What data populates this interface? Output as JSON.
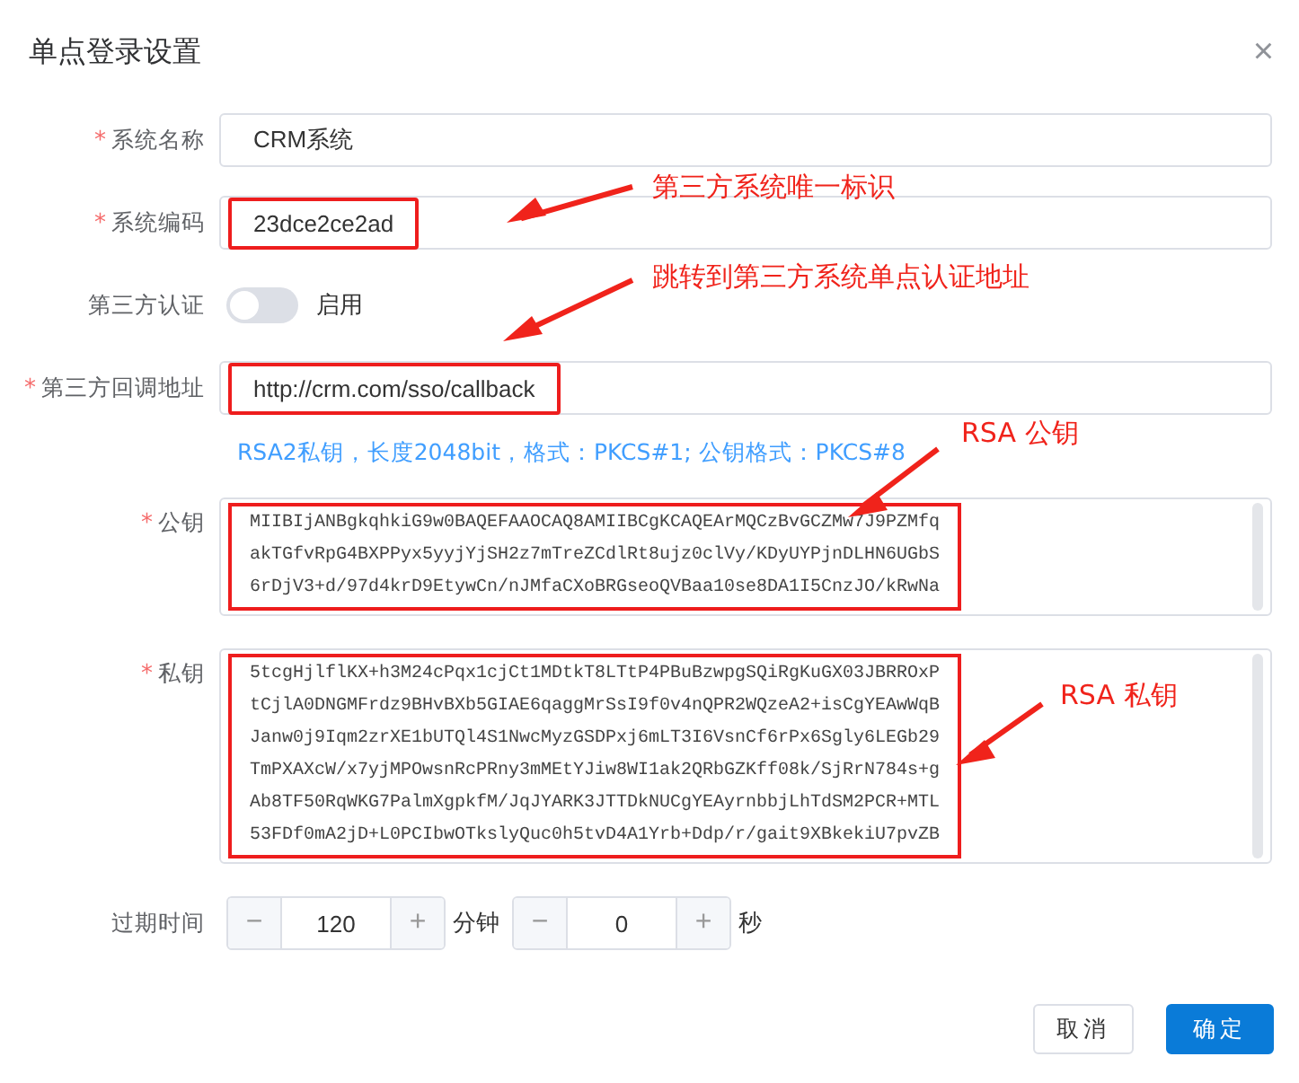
{
  "dialog": {
    "title": "单点登录设置",
    "close": "×"
  },
  "fields": [
    {
      "kind": "input",
      "required_mark": "*",
      "label": "系统名称",
      "value": "CRM系统",
      "highlighted": false
    },
    {
      "kind": "input",
      "required_mark": "*",
      "label": "系统编码",
      "value": "23dce2ce2ad",
      "highlighted": true
    },
    {
      "kind": "switch",
      "label": "第三方认证",
      "on": false,
      "switch_label": "启用"
    },
    {
      "kind": "input",
      "required_mark": "*",
      "label": "第三方回调地址",
      "value": "http://crm.com/sso/callback",
      "highlighted": true
    },
    {
      "kind": "hint",
      "text": "RSA2私钥，长度2048bit，格式：PKCS#1; 公钥格式：PKCS#8"
    },
    {
      "kind": "textarea",
      "required_mark": "*",
      "label": "公钥",
      "highlighted": true,
      "lines": [
        "MIIBIjANBgkqhkiG9w0BAQEFAAOCAQ8AMIIBCgKCAQEArMQCzBvGCZMw7J9PZMfq",
        "akTGfvRpG4BXPPyx5yyjYjSH2z7mTreZCdlRt8ujz0clVy/KDyUYPjnDLHN6UGbS",
        "6rDjV3+d/97d4krD9EtywCn/nJMfaCXoBRGseoQVBaa10se8DA1I5CnzJO/kRwNa"
      ]
    },
    {
      "kind": "textarea",
      "required_mark": "*",
      "label": "私钥",
      "highlighted": true,
      "lines": [
        "5tcgHjlflKX+h3M24cPqx1cjCt1MDtkT8LTtP4PBuBzwpgSQiRgKuGX03JBRROxP",
        "tCjlA0DNGMFrdz9BHvBXb5GIAE6qaggMrSsI9f0v4nQPR2WQzeA2+isCgYEAwWqB",
        "Janw0j9Iqm2zrXE1bUTQl4S1NwcMyzGSDPxj6mLT3I6VsnCf6rPx6Sgly6LEGb29",
        "TmPXAXcW/x7yjMPOwsnRcPRny3mMEtYJiw8WI1ak2QRbGZKff08k/SjRrN784s+g",
        "Ab8TF50RqWKG7PalmXgpkfM/JqJYARK3JTTDkNUCgYEAyrnbbjLhTdSM2PCR+MTL",
        "53FDf0mA2jD+L0PCIbwOTkslyQuc0h5tvD4A1Yrb+Ddp/r/gait9XBkekiU7pvZB"
      ]
    },
    {
      "kind": "duration",
      "label": "过期时间",
      "parts": [
        {
          "minus": "−",
          "value": "120",
          "plus": "+",
          "unit": "分钟"
        },
        {
          "minus": "−",
          "value": "0",
          "plus": "+",
          "unit": "秒"
        }
      ]
    }
  ],
  "annotations": [
    {
      "text": "第三方系统唯一标识"
    },
    {
      "text": "跳转到第三方系统单点认证地址"
    },
    {
      "text": "RSA 公钥"
    },
    {
      "text": "RSA 私钥"
    }
  ],
  "buttons": [
    {
      "label": "取消",
      "primary": false
    },
    {
      "label": "确定",
      "primary": true
    }
  ]
}
